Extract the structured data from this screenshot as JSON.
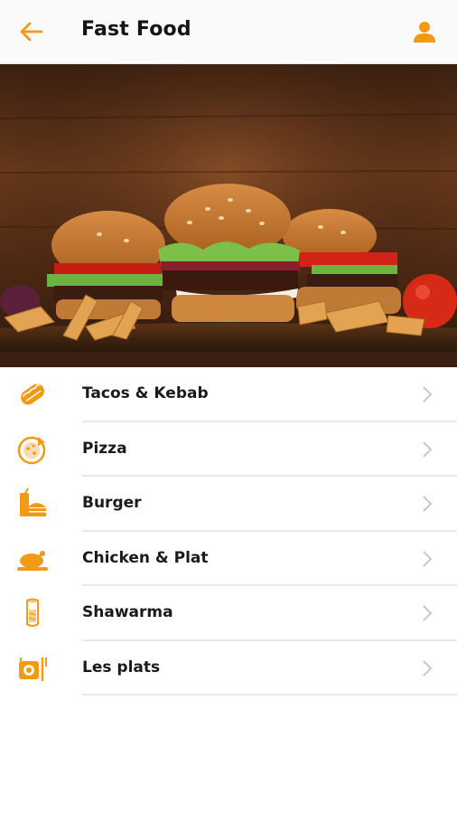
{
  "header": {
    "title": "Fast Food",
    "accent_color": "#F29A16",
    "back_icon": "arrow-left-icon",
    "profile_icon": "user-icon"
  },
  "hero": {
    "description_icon": "burgers-photo"
  },
  "menu": {
    "items": [
      {
        "label": "Tacos & Kebab",
        "icon": "taco-icon"
      },
      {
        "label": "Pizza",
        "icon": "pizza-icon"
      },
      {
        "label": "Burger",
        "icon": "burger-drink-icon"
      },
      {
        "label": "Chicken & Plat",
        "icon": "roast-chicken-icon"
      },
      {
        "label": "Shawarma",
        "icon": "shawarma-wrap-icon"
      },
      {
        "label": "Les plats",
        "icon": "plate-icon"
      }
    ]
  }
}
